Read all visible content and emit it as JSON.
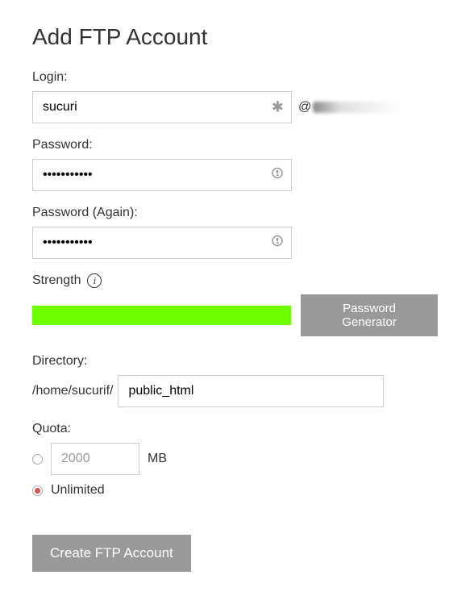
{
  "title": "Add FTP Account",
  "login": {
    "label": "Login:",
    "value": "sucuri",
    "at": "@"
  },
  "password": {
    "label": "Password:",
    "value": "•••••••••••"
  },
  "password_again": {
    "label": "Password (Again):",
    "value": "•••••••••••"
  },
  "strength": {
    "label": "Strength",
    "bar_color": "#6fff00",
    "generator_button": "Password Generator"
  },
  "directory": {
    "label": "Directory:",
    "prefix": "/home/sucurif/",
    "value": "public_html"
  },
  "quota": {
    "label": "Quota:",
    "size_value": "2000",
    "unit": "MB",
    "unlimited_label": "Unlimited",
    "selected": "unlimited"
  },
  "submit_label": "Create FTP Account"
}
